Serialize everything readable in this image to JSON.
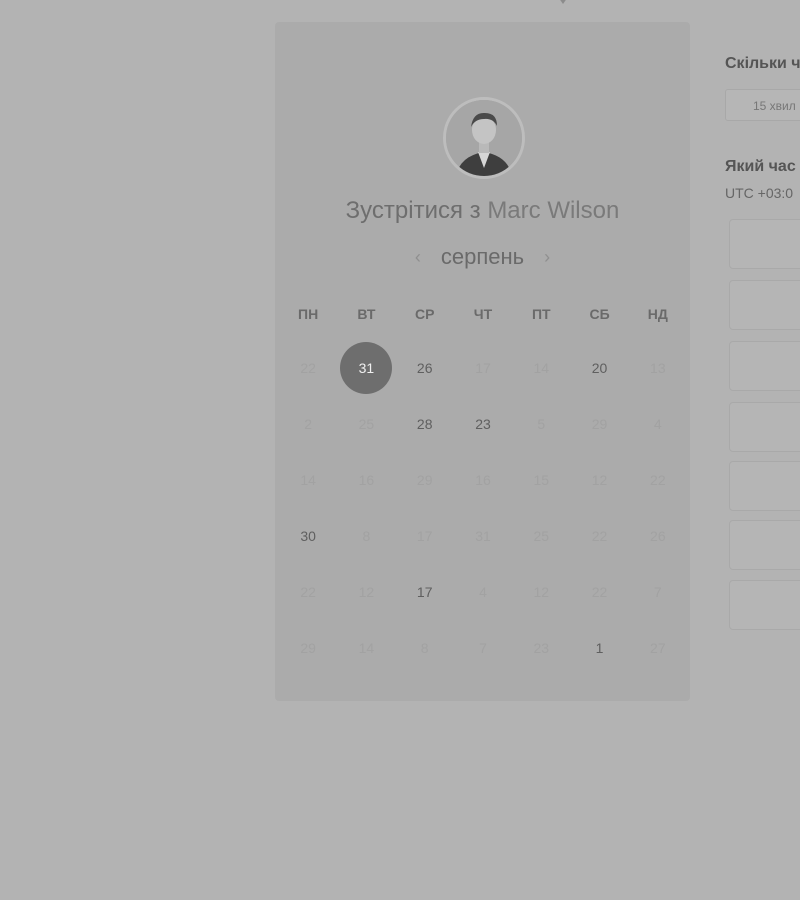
{
  "meeting": {
    "title_prefix": "Зустрітися з",
    "host_name": "Marc Wilson"
  },
  "calendar": {
    "month": "серпень",
    "prev_icon": "chevron-left-icon",
    "next_icon": "chevron-right-icon",
    "weekdays": [
      "ПН",
      "ВТ",
      "СР",
      "ЧТ",
      "ПТ",
      "СБ",
      "НД"
    ],
    "weeks": [
      [
        {
          "label": "22",
          "state": "disabled"
        },
        {
          "label": "31",
          "state": "selected"
        },
        {
          "label": "26",
          "state": "available"
        },
        {
          "label": "17",
          "state": "disabled"
        },
        {
          "label": "14",
          "state": "disabled"
        },
        {
          "label": "20",
          "state": "available"
        },
        {
          "label": "13",
          "state": "disabled"
        }
      ],
      [
        {
          "label": "2",
          "state": "disabled"
        },
        {
          "label": "25",
          "state": "disabled"
        },
        {
          "label": "28",
          "state": "available"
        },
        {
          "label": "23",
          "state": "available"
        },
        {
          "label": "5",
          "state": "disabled"
        },
        {
          "label": "29",
          "state": "disabled"
        },
        {
          "label": "4",
          "state": "disabled"
        }
      ],
      [
        {
          "label": "14",
          "state": "disabled"
        },
        {
          "label": "16",
          "state": "disabled"
        },
        {
          "label": "29",
          "state": "disabled"
        },
        {
          "label": "16",
          "state": "disabled"
        },
        {
          "label": "15",
          "state": "disabled"
        },
        {
          "label": "12",
          "state": "disabled"
        },
        {
          "label": "22",
          "state": "disabled"
        }
      ],
      [
        {
          "label": "30",
          "state": "available"
        },
        {
          "label": "8",
          "state": "disabled"
        },
        {
          "label": "17",
          "state": "disabled"
        },
        {
          "label": "31",
          "state": "disabled"
        },
        {
          "label": "25",
          "state": "disabled"
        },
        {
          "label": "22",
          "state": "disabled"
        },
        {
          "label": "26",
          "state": "disabled"
        }
      ],
      [
        {
          "label": "22",
          "state": "disabled"
        },
        {
          "label": "12",
          "state": "disabled"
        },
        {
          "label": "17",
          "state": "available"
        },
        {
          "label": "4",
          "state": "disabled"
        },
        {
          "label": "12",
          "state": "disabled"
        },
        {
          "label": "22",
          "state": "disabled"
        },
        {
          "label": "7",
          "state": "disabled"
        }
      ],
      [
        {
          "label": "29",
          "state": "disabled"
        },
        {
          "label": "14",
          "state": "disabled"
        },
        {
          "label": "8",
          "state": "disabled"
        },
        {
          "label": "7",
          "state": "disabled"
        },
        {
          "label": "23",
          "state": "disabled"
        },
        {
          "label": "1",
          "state": "available"
        },
        {
          "label": "27",
          "state": "disabled"
        }
      ]
    ]
  },
  "booking": {
    "duration_heading": "Скільки ч",
    "duration_value": "15 хвил",
    "time_heading": "Який час",
    "timezone": "UTC +03:0",
    "slot_count": 7
  },
  "colors": {
    "overlay": "#b3b3b3",
    "selected_day": "#6e6e6e"
  }
}
